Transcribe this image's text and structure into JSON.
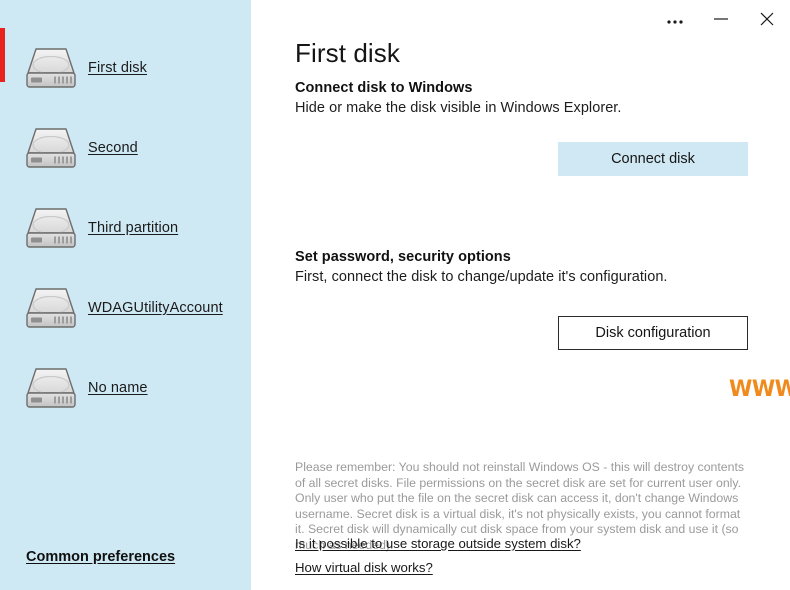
{
  "window": {
    "controls": [
      {
        "name": "more-options",
        "label": "···",
        "icon": "ellipsis-icon"
      },
      {
        "name": "minimize",
        "label": "—",
        "icon": "minimize-icon"
      },
      {
        "name": "close",
        "label": "✕",
        "icon": "close-icon"
      }
    ]
  },
  "sidebar": {
    "background_color": "#cfe9f4",
    "selection_color": "#e8221d",
    "items": [
      {
        "label": "First disk",
        "icon": "disk-icon",
        "selected": true
      },
      {
        "label": "Second",
        "icon": "disk-icon",
        "selected": false
      },
      {
        "label": "Third partition",
        "icon": "disk-icon",
        "selected": false
      },
      {
        "label": "WDAGUtilityAccount",
        "icon": "disk-icon",
        "selected": false
      },
      {
        "label": "No name",
        "icon": "disk-icon",
        "selected": false
      }
    ],
    "common_preferences": "Common preferences"
  },
  "main": {
    "title": "First disk",
    "sections": [
      {
        "heading": "Connect disk to Windows",
        "description": "Hide or make the disk visible in Windows Explorer.",
        "button": "Connect disk",
        "button_style": "filled",
        "button_color": "#cfe8f3"
      },
      {
        "heading": "Set password, security options",
        "description": "First, connect the disk to change/update it's configuration.",
        "button": "Disk configuration",
        "button_style": "outlined",
        "button_color": "#ffffff"
      }
    ],
    "watermark": {
      "text": "WWW.MAZTERIZES.COM",
      "color": "#f08a1c"
    },
    "disclaimer": "Please remember: You should not reinstall Windows OS - this will destroy contents of all secret disks. File permissions on the secret disk are set for current user only. Only user who put the file on the secret disk can access it, don't change Windows username. Secret disk is a virtual disk, it's not physically exists, you cannot format it. Secret disk will dynamically cut disk space from your system disk and use it (so much as needed).",
    "links": [
      "Is it possible to use storage outside system disk?",
      "How virtual disk works?"
    ]
  }
}
